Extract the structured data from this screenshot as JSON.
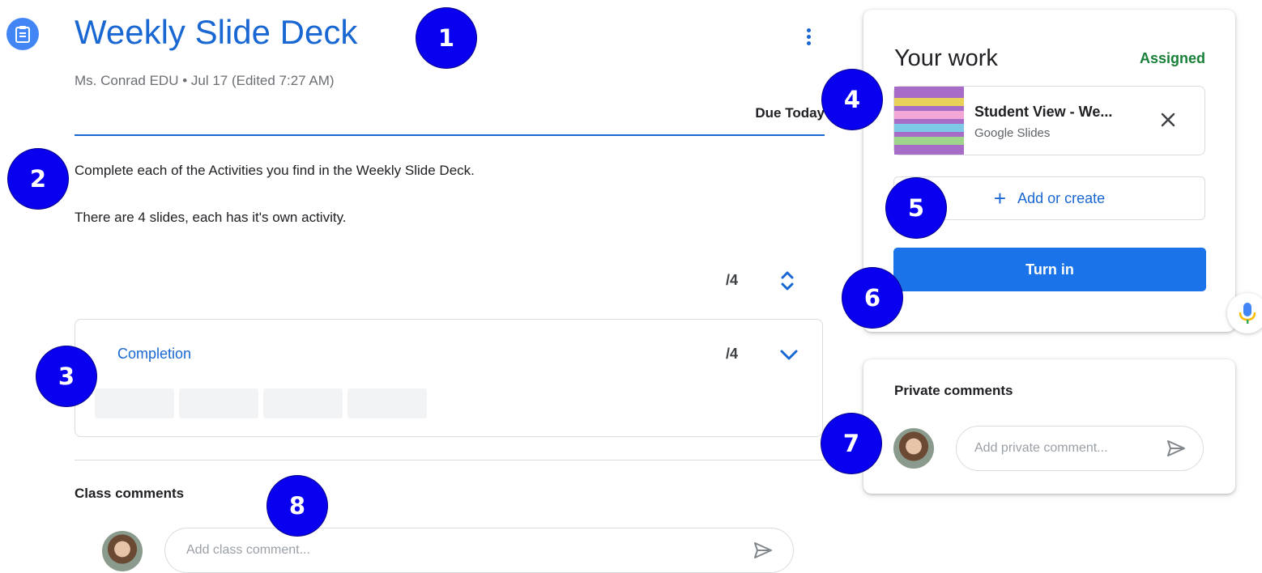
{
  "header": {
    "title": "Weekly Slide Deck",
    "meta": "Ms. Conrad EDU • Jul 17 (Edited 7:27 AM)",
    "due": "Due Today",
    "icon": "assignment-icon"
  },
  "instructions": {
    "line1": "Complete each of the Activities you find in the Weekly Slide Deck.",
    "line2": "There are 4 slides, each has it's own activity."
  },
  "grading": {
    "points": "/4"
  },
  "rubric": {
    "criterion": "Completion",
    "points": "/4",
    "levels": 4
  },
  "class_comments": {
    "label": "Class comments",
    "placeholder": "Add class comment..."
  },
  "your_work": {
    "title": "Your work",
    "status": "Assigned",
    "attachment": {
      "name": "Student View - We...",
      "type": "Google Slides"
    },
    "add_label": "Add or create",
    "turn_in_label": "Turn in"
  },
  "private_comments": {
    "label": "Private comments",
    "placeholder": "Add private comment..."
  },
  "markers": [
    "1",
    "2",
    "3",
    "4",
    "5",
    "6",
    "7",
    "8"
  ],
  "colors": {
    "accent": "#1967d2",
    "status_green": "#188038",
    "marker_blue": "#0a00f0",
    "button_blue": "#1a73e8"
  }
}
